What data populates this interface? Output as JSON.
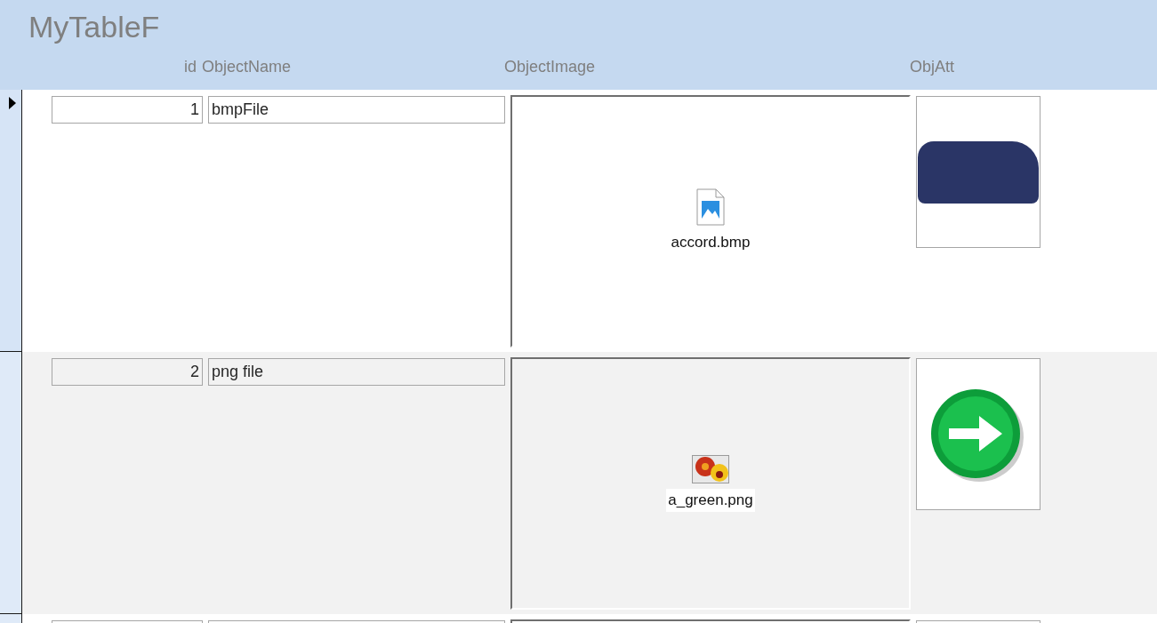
{
  "form": {
    "title": "MyTableF"
  },
  "columns": [
    "id",
    "ObjectName",
    "ObjectImage",
    "ObjAtt"
  ],
  "rows": [
    {
      "id": "1",
      "object_name": "bmpFile",
      "image_file": {
        "kind": "bmp",
        "filename": "accord.bmp"
      },
      "attachment": {
        "kind": "photo"
      },
      "current": true
    },
    {
      "id": "2",
      "object_name": "png file",
      "image_file": {
        "kind": "png",
        "filename": "a_green.png"
      },
      "attachment": {
        "kind": "arrow"
      },
      "current": false
    }
  ],
  "new_record_row": true
}
